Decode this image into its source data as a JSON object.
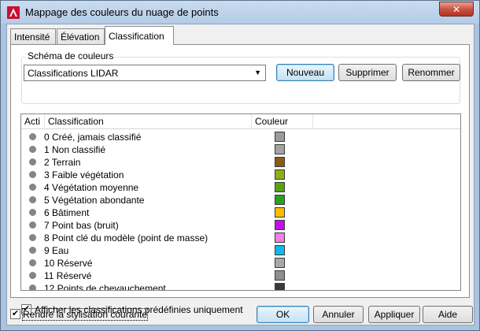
{
  "window": {
    "title": "Mappage des couleurs du nuage de points",
    "close_label": "✕"
  },
  "tabs": [
    {
      "label": "Intensité",
      "active": false
    },
    {
      "label": "Élévation",
      "active": false
    },
    {
      "label": "Classification",
      "active": true
    }
  ],
  "scheme": {
    "group_label": "Schéma de couleurs",
    "selected": "Classifications LIDAR",
    "new_label": "Nouveau",
    "delete_label": "Supprimer",
    "rename_label": "Renommer"
  },
  "list": {
    "headers": {
      "active": "Acti",
      "classification": "Classification",
      "color": "Couleur"
    },
    "rows": [
      {
        "label": "0 Créé, jamais classifié",
        "color": "#9b9b9b"
      },
      {
        "label": "1 Non classifié",
        "color": "#a3a3a3"
      },
      {
        "label": "2 Terrain",
        "color": "#8a5c16"
      },
      {
        "label": "3 Faible végétation",
        "color": "#8fae1b"
      },
      {
        "label": "4 Végétation moyenne",
        "color": "#55a30f"
      },
      {
        "label": "5 Végétation abondante",
        "color": "#26a21c"
      },
      {
        "label": "6 Bâtiment",
        "color": "#f7bd00"
      },
      {
        "label": "7 Point bas (bruit)",
        "color": "#c210e8"
      },
      {
        "label": "8 Point clé du modèle (point de masse)",
        "color": "#f07fe8"
      },
      {
        "label": "9 Eau",
        "color": "#12b8ec"
      },
      {
        "label": "10 Réservé",
        "color": "#a8a8a8"
      },
      {
        "label": "11 Réservé",
        "color": "#8f8f8f"
      },
      {
        "label": "12 Points de chevauchement",
        "color": "#3a3a3a"
      }
    ]
  },
  "predefined_only": {
    "label": "Afficher les classifications prédéfinies uniquement",
    "checked": true
  },
  "make_current": {
    "label": "Rendre la stylisation courante",
    "checked": true
  },
  "buttons": {
    "ok": "OK",
    "cancel": "Annuler",
    "apply": "Appliquer",
    "help": "Aide"
  }
}
